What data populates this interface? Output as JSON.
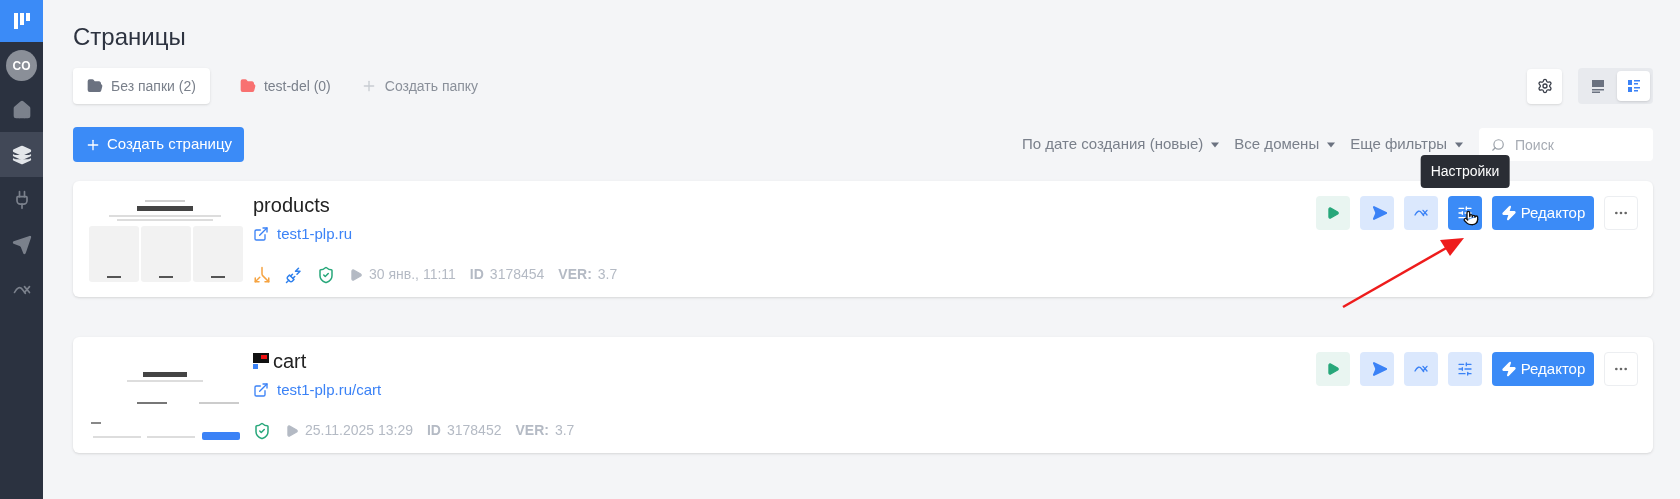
{
  "sidebar": {
    "avatar": "CO",
    "items": [
      {
        "kind": "home",
        "selected": false
      },
      {
        "kind": "pages",
        "selected": true
      },
      {
        "kind": "integrations",
        "selected": false
      },
      {
        "kind": "send",
        "selected": false
      },
      {
        "kind": "analytics",
        "selected": false
      }
    ]
  },
  "page_title": "Страницы",
  "folders": [
    {
      "label": "Без папки (2)",
      "selected": true,
      "color": "#6b7280"
    },
    {
      "label": "test-del (0)",
      "selected": false,
      "color": "#f87171"
    }
  ],
  "create_folder": "Создать папку",
  "view_modes": [
    {
      "kind": "cards",
      "selected": false
    },
    {
      "kind": "list",
      "selected": true
    }
  ],
  "create_page": "Создать страницу",
  "filters": [
    "По дате создания (новые)",
    "Все домены",
    "Еще фильтры"
  ],
  "search": {
    "placeholder": "Поиск"
  },
  "pages": [
    {
      "name": "products",
      "favicon": false,
      "thumbnail": {
        "kind": "picture"
      },
      "url": "test1-plp.ru",
      "badges": [
        {
          "kind": "ab-test"
        },
        {
          "kind": "integration"
        },
        {
          "kind": "ssl"
        }
      ],
      "date": "30 янв., 11:11",
      "id_label": "ID",
      "id": "3178454",
      "ver_label": "VER:",
      "ver": "3.7",
      "editor": "Редактор",
      "actions": [
        {
          "kind": "preview",
          "active": false
        },
        {
          "kind": "send",
          "active": false
        },
        {
          "kind": "stats",
          "active": false
        },
        {
          "kind": "settings",
          "active": true,
          "tooltip": "Настройки"
        }
      ]
    },
    {
      "name": "cart",
      "favicon": true,
      "thumbnail": {
        "kind": "picture"
      },
      "url": "test1-plp.ru/cart",
      "badges": [
        {
          "kind": "ssl"
        }
      ],
      "date": "25.11.2025 13:29",
      "id_label": "ID",
      "id": "3178452",
      "ver_label": "VER:",
      "ver": "3.7",
      "editor": "Редактор",
      "actions": [
        {
          "kind": "preview",
          "active": false
        },
        {
          "kind": "send",
          "active": false
        },
        {
          "kind": "stats",
          "active": false
        },
        {
          "kind": "settings",
          "active": false
        }
      ]
    }
  ]
}
